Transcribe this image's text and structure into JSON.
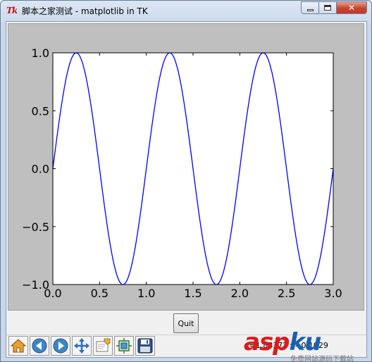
{
  "window": {
    "title": "脚本之家测试 - matplotlib in TK",
    "logo_text": "Tk"
  },
  "chart_data": {
    "type": "line",
    "function": "sin(2*pi*t)",
    "series": [
      {
        "x_start": 0.0,
        "x_end": 3.0,
        "frequency": 1.0,
        "amplitude": 1.0,
        "color": "#0000ff"
      }
    ],
    "xlim": [
      0.0,
      3.0
    ],
    "ylim": [
      -1.0,
      1.0
    ],
    "xticks": [
      0.0,
      0.5,
      1.0,
      1.5,
      2.0,
      2.5,
      3.0
    ],
    "xtick_labels": [
      "0.0",
      "0.5",
      "1.0",
      "1.5",
      "2.0",
      "2.5",
      "3.0"
    ],
    "yticks": [
      1.0,
      0.5,
      0.0,
      -0.5,
      -1.0
    ],
    "ytick_labels": [
      "1.0",
      "0.5",
      "0.0",
      "−0.5",
      "−1.0"
    ],
    "grid": false,
    "title": "",
    "xlabel": "",
    "ylabel": ""
  },
  "buttons": {
    "quit_label": "Quit"
  },
  "toolbar": {
    "items": [
      {
        "name": "home-icon"
      },
      {
        "name": "back-icon"
      },
      {
        "name": "forward-icon"
      },
      {
        "name": "pan-icon"
      },
      {
        "name": "zoom-icon"
      },
      {
        "name": "subplots-icon"
      },
      {
        "name": "save-icon"
      }
    ],
    "coords_text": "x=1.88372    y=0.1029"
  },
  "watermark": {
    "asp": "asp",
    "ku": "ku",
    "sub": "免费网站源码下载站"
  }
}
